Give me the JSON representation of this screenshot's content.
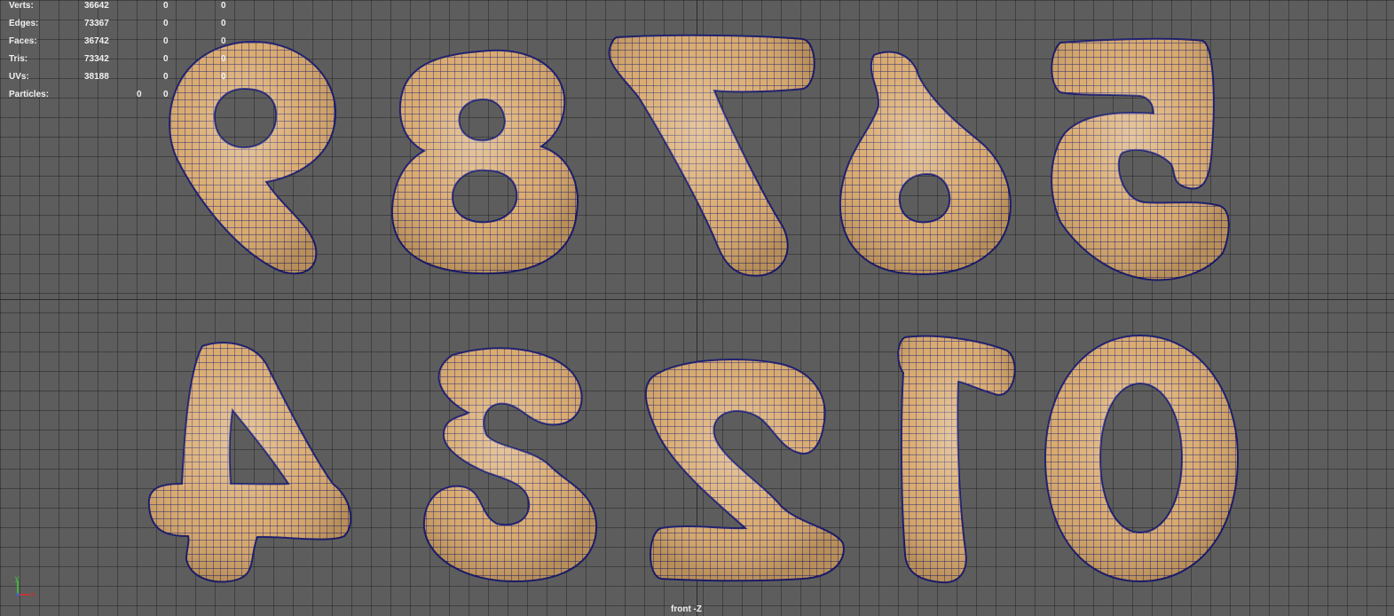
{
  "hud": {
    "rows": [
      {
        "label": "Verts:",
        "c1": "36642",
        "c2": "0",
        "c3": "0"
      },
      {
        "label": "Edges:",
        "c1": "73367",
        "c2": "0",
        "c3": "0"
      },
      {
        "label": "Faces:",
        "c1": "36742",
        "c2": "0",
        "c3": "0"
      },
      {
        "label": "Tris:",
        "c1": "73342",
        "c2": "0",
        "c3": "0"
      },
      {
        "label": "UVs:",
        "c1": "38188",
        "c2": "0",
        "c3": "0"
      }
    ],
    "particles": {
      "label": "Particles:",
      "c1": "0",
      "c2": "0"
    }
  },
  "viewport": {
    "camera_label": "front -Z"
  },
  "gizmo": {
    "y_label": "y",
    "x_label": "x"
  },
  "colors": {
    "viewport_bg": "#5d5d5d",
    "mesh_fill": "#d9a86a",
    "mesh_wire": "#1c1d6e",
    "gizmo_x": "#e02a2a",
    "gizmo_y": "#3ad13a",
    "gizmo_z": "#3a62e6"
  },
  "meshes": [
    "9",
    "8",
    "7",
    "6",
    "5",
    "4",
    "3",
    "2",
    "1",
    "0"
  ]
}
